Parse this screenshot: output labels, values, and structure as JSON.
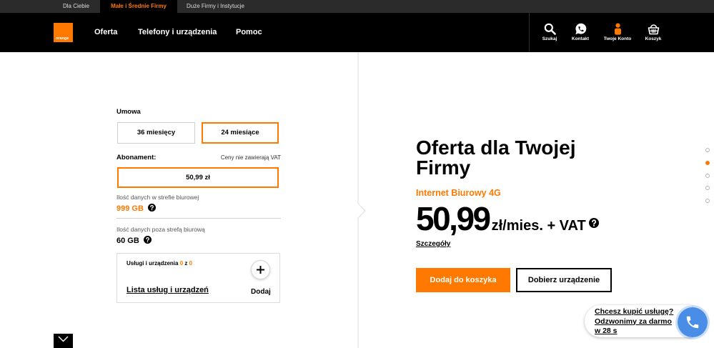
{
  "topbar": {
    "tabs": [
      {
        "label": "Dla Ciebie",
        "active": false
      },
      {
        "label": "Małe i Średnie Firmy",
        "active": true
      },
      {
        "label": "Duże Firmy i Instytucje",
        "active": false
      }
    ]
  },
  "header": {
    "logo_text": "orange",
    "nav": [
      {
        "label": "Oferta"
      },
      {
        "label": "Telefony i urządzenia"
      },
      {
        "label": "Pomoc"
      }
    ],
    "actions": [
      {
        "label": "Szukaj",
        "icon": "search-icon"
      },
      {
        "label": "Kontakt",
        "icon": "contact-icon"
      },
      {
        "label": "Twoje Konto",
        "icon": "account-icon"
      },
      {
        "label": "Koszyk",
        "icon": "basket-icon"
      }
    ]
  },
  "configurator": {
    "contract_label": "Umowa",
    "contract_options": [
      {
        "label": "36 miesięcy",
        "selected": false
      },
      {
        "label": "24 miesiące",
        "selected": true
      }
    ],
    "subscription_label": "Abonament:",
    "vat_note": "Ceny nie zawierają VAT",
    "price_options": [
      {
        "label": "50,99 zł",
        "selected": true
      }
    ],
    "data_office_label": "Ilość danych w strefie biurowej",
    "data_office_value": "999 GB",
    "data_outside_label": "Ilość danych poza strefą biurową",
    "data_outside_value": "60 GB",
    "services": {
      "label": "Usługi i urządzenia",
      "count": "0",
      "separator": "z",
      "total": "0",
      "list_link": "Lista usług i urządzeń",
      "add_label": "Dodaj"
    }
  },
  "offer": {
    "title": "Oferta dla Twojej Firmy",
    "product": "Internet Biurowy 4G",
    "price": "50,99",
    "price_suffix": "zł/mies. + VAT",
    "details_link": "Szczegóły",
    "add_to_cart": "Dodaj do koszyka",
    "choose_device": "Dobierz urządzenie"
  },
  "section_nav": {
    "dots": [
      {
        "active": false
      },
      {
        "active": true
      },
      {
        "active": false
      },
      {
        "active": false
      },
      {
        "active": false
      }
    ]
  },
  "callback": {
    "lines": [
      "Chcesz kupić usługę?",
      "Odzwonimy za darmo",
      "w 28 s"
    ],
    "icon": "phone-icon"
  },
  "colors": {
    "accent": "#ff7900",
    "header_bg": "#000000",
    "topbar_bg": "#2b2b2b",
    "callback_blue": "#4a8de6"
  }
}
